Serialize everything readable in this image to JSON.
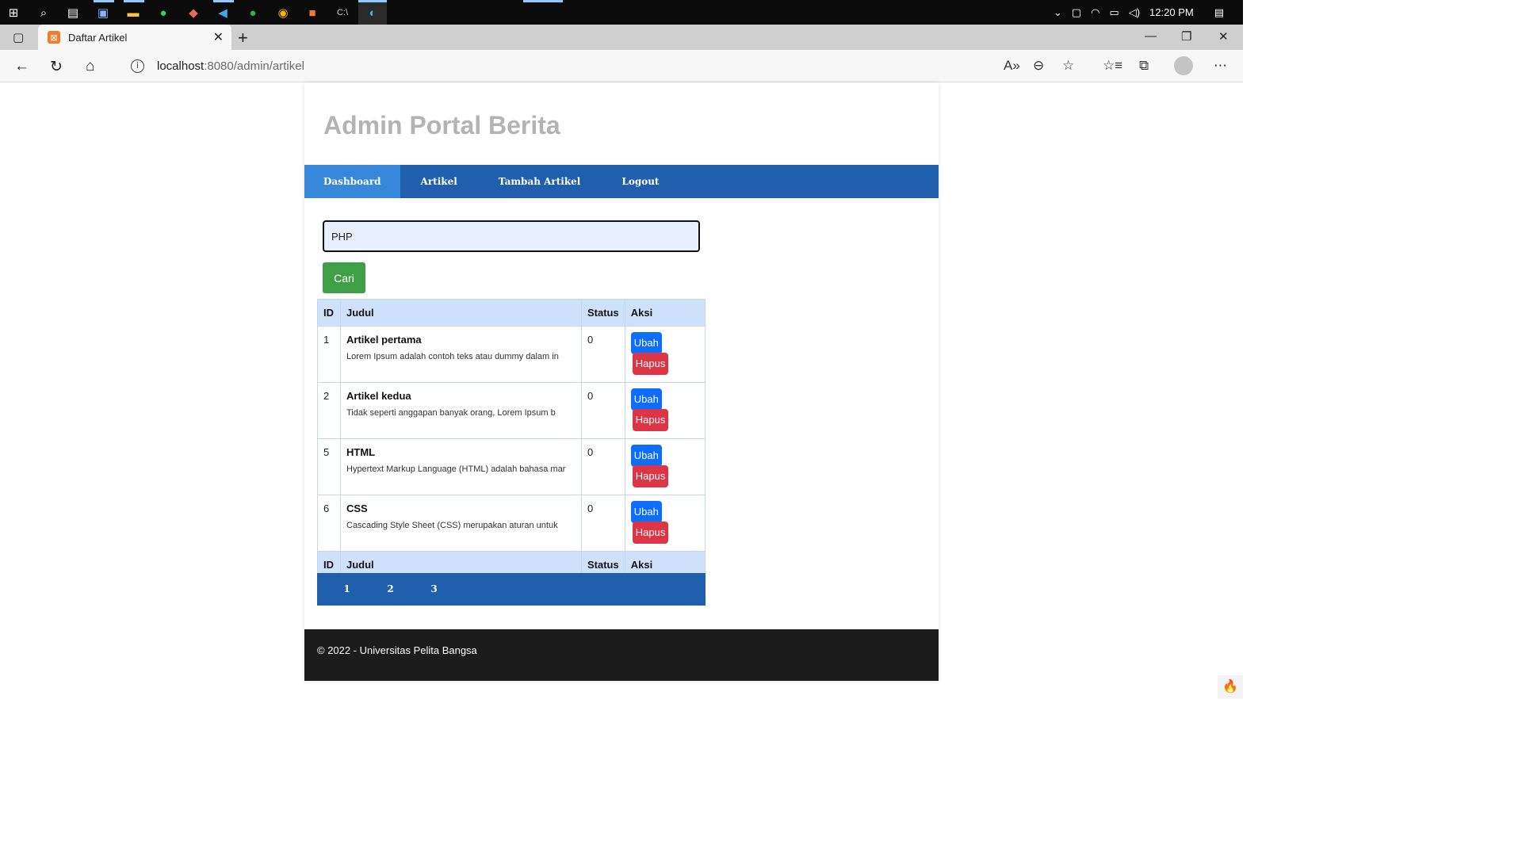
{
  "taskbar": {
    "clock": "12:20 PM",
    "icons": [
      "windows-start-icon",
      "search-icon",
      "task-view-icon",
      "photos-icon",
      "file-explorer-icon",
      "whatsapp-icon",
      "app-icon",
      "vscode-icon",
      "spotify-icon",
      "chrome-icon",
      "xampp-icon",
      "terminal-icon",
      "edge-icon"
    ]
  },
  "browser": {
    "tab_title": "Daftar Artikel",
    "url_host": "localhost",
    "url_rest": ":8080/admin/artikel"
  },
  "page": {
    "title": "Admin Portal Berita",
    "nav": [
      {
        "label": "Dashboard",
        "active": true
      },
      {
        "label": "Artikel",
        "active": false
      },
      {
        "label": "Tambah Artikel",
        "active": false
      },
      {
        "label": "Logout",
        "active": false
      }
    ],
    "search": {
      "value": "PHP",
      "button": "Cari"
    },
    "table": {
      "headers": [
        "ID",
        "Judul",
        "Status",
        "Aksi"
      ],
      "rows": [
        {
          "id": "1",
          "judul": "Artikel pertama",
          "snippet": "Lorem Ipsum adalah contoh teks atau dummy dalam in",
          "status": "0"
        },
        {
          "id": "2",
          "judul": "Artikel kedua",
          "snippet": "Tidak seperti anggapan banyak orang, Lorem Ipsum b",
          "status": "0"
        },
        {
          "id": "5",
          "judul": "HTML",
          "snippet": "Hypertext Markup Language (HTML) adalah bahasa mar",
          "status": "0"
        },
        {
          "id": "6",
          "judul": "CSS",
          "snippet": "Cascading Style Sheet (CSS) merupakan aturan untuk",
          "status": "0"
        }
      ],
      "edit_label": "Ubah",
      "delete_label": "Hapus"
    },
    "pagination": [
      "1",
      "2",
      "3"
    ],
    "footer": "© 2022 - Universitas Pelita Bangsa"
  },
  "colors": {
    "nav_bg": "#1f5fad",
    "nav_active": "#3787db",
    "cari_green": "#3e9f47",
    "ubah_blue": "#0d6efd",
    "hapus_red": "#dc3545"
  }
}
